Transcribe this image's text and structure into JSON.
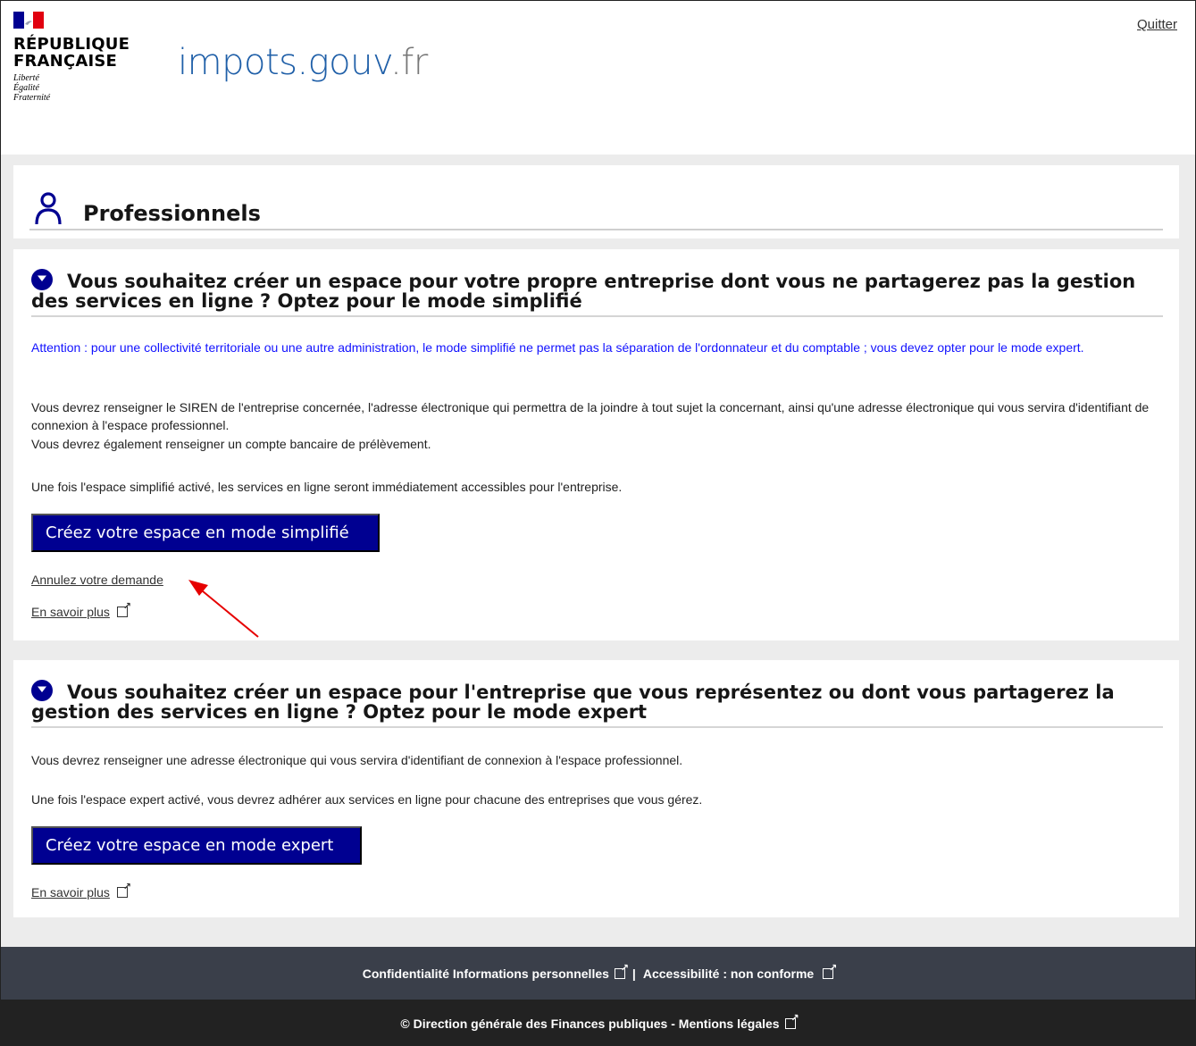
{
  "header": {
    "rf_line1": "RÉPUBLIQUE",
    "rf_line2": "FRANÇAISE",
    "motto1": "Liberté",
    "motto2": "Égalité",
    "motto3": "Fraternité",
    "brand_main": "impots.gouv",
    "brand_ext": ".fr",
    "quit_label": "Quitter"
  },
  "page": {
    "title": "Professionnels",
    "title_icon": "user-icon"
  },
  "section_simple": {
    "heading": "Vous souhaitez créer un espace pour votre propre entreprise dont vous ne partagerez pas la gestion des services en ligne ? Optez pour le mode simplifié",
    "warning": "Attention : pour une collectivité territoriale ou une autre administration, le mode simplifié ne permet pas la séparation de l'ordonnateur et du comptable ; vous devez opter pour le mode expert.",
    "para1": "Vous devrez renseigner le SIREN de l'entreprise concernée, l'adresse électronique qui permettra de la joindre à tout sujet la concernant, ainsi qu'une adresse électronique qui vous servira d'identifiant de connexion à l'espace professionnel.",
    "para2": "Vous devrez également renseigner un compte bancaire de prélèvement.",
    "para3": "Une fois l'espace simplifié activé, les services en ligne seront immédiatement accessibles pour l'entreprise.",
    "button_label": "Créez votre espace en mode simplifié",
    "cancel_link": "Annulez votre demande",
    "more_link": "En savoir plus"
  },
  "section_expert": {
    "heading": "Vous souhaitez créer un espace pour l'entreprise que vous représentez ou dont vous partagerez la gestion des services en ligne ? Optez pour le mode expert",
    "para1": "Vous devrez renseigner une adresse électronique qui vous servira d'identifiant de connexion à l'espace professionnel.",
    "para2": "Une fois l'espace expert activé, vous devrez adhérer aux services en ligne pour chacune des entreprises que vous gérez.",
    "button_label": "Créez votre espace en mode expert",
    "more_link": "En savoir plus"
  },
  "footer": {
    "privacy_link": "Confidentialité Informations personnelles",
    "separator": "|",
    "accessibility_link": "Accessibilité : non conforme",
    "copyright": "© Direction générale des Finances publiques - Mentions légales"
  },
  "colors": {
    "primary": "#000091",
    "warning_text": "#1212ff",
    "annotation_arrow": "#e60000"
  }
}
